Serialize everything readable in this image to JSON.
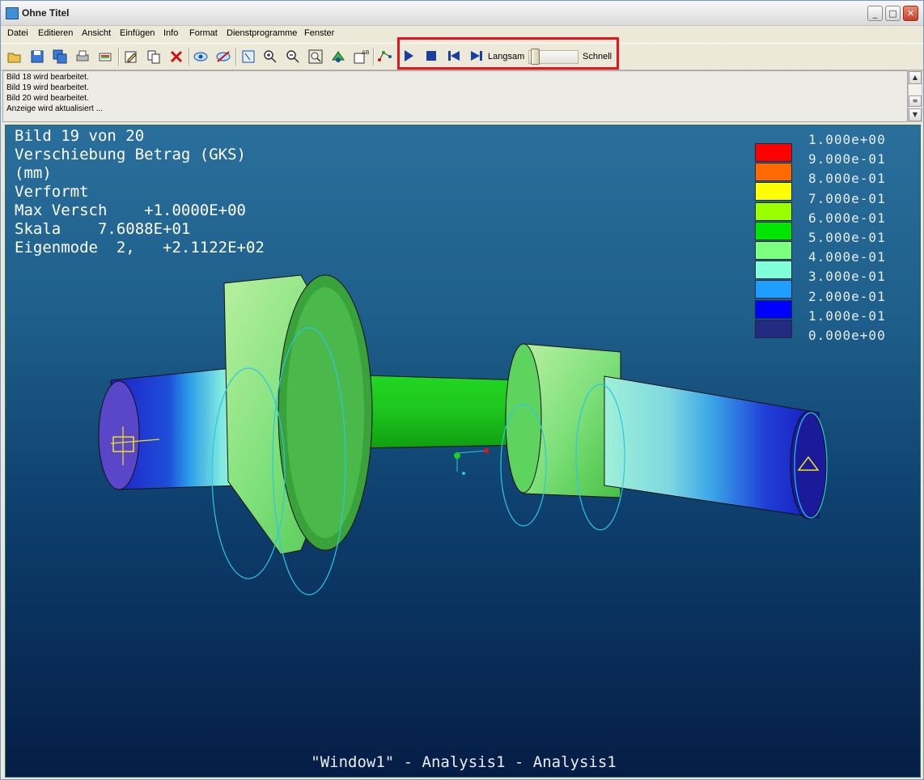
{
  "window": {
    "title": "Ohne Titel"
  },
  "menu": [
    "Datei",
    "Editieren",
    "Ansicht",
    "Einfügen",
    "Info",
    "Format",
    "Dienstprogramme",
    "Fenster"
  ],
  "toolbar": {
    "icons": [
      "open-icon",
      "save-icon",
      "save-all-icon",
      "print-icon",
      "color-print-icon",
      "edit-icon",
      "copy-icon",
      "delete-icon",
      "show-icon",
      "hide-icon",
      "select-icon",
      "zoom-in-icon",
      "zoom-out-icon",
      "zoom-fit-icon",
      "orient-icon",
      "label-icon",
      "graph-icon"
    ],
    "animation": {
      "play": "play-icon",
      "stop": "stop-icon",
      "first": "skip-first-icon",
      "last": "skip-last-icon",
      "slow_label": "Langsam",
      "fast_label": "Schnell",
      "speed": 0.05
    }
  },
  "log": [
    "Bild 18 wird bearbeitet.",
    "Bild 19 wird bearbeitet.",
    "Bild 20 wird bearbeitet.",
    "Anzeige wird aktualisiert ..."
  ],
  "viewport": {
    "info": [
      "Bild 19 von 20",
      "Verschiebung Betrag (GKS)",
      "(mm)",
      "Verformt",
      "Max Versch    +1.0000E+00",
      "Skala    7.6088E+01",
      "Eigenmode  2,   +2.1122E+02"
    ],
    "legend": [
      {
        "label": "1.000e+00",
        "color": ""
      },
      {
        "label": "9.000e-01",
        "color": "#ff0000"
      },
      {
        "label": "8.000e-01",
        "color": "#ff6a00"
      },
      {
        "label": "7.000e-01",
        "color": "#ffff00"
      },
      {
        "label": "6.000e-01",
        "color": "#99ff00"
      },
      {
        "label": "5.000e-01",
        "color": "#00e600"
      },
      {
        "label": "4.000e-01",
        "color": "#7dff80"
      },
      {
        "label": "3.000e-01",
        "color": "#80ffd8"
      },
      {
        "label": "2.000e-01",
        "color": "#1e9fff"
      },
      {
        "label": "1.000e-01",
        "color": "#0000ff"
      },
      {
        "label": "0.000e+00",
        "color": "#232b80"
      }
    ],
    "footer": "\"Window1\" - Analysis1 - Analysis1"
  }
}
